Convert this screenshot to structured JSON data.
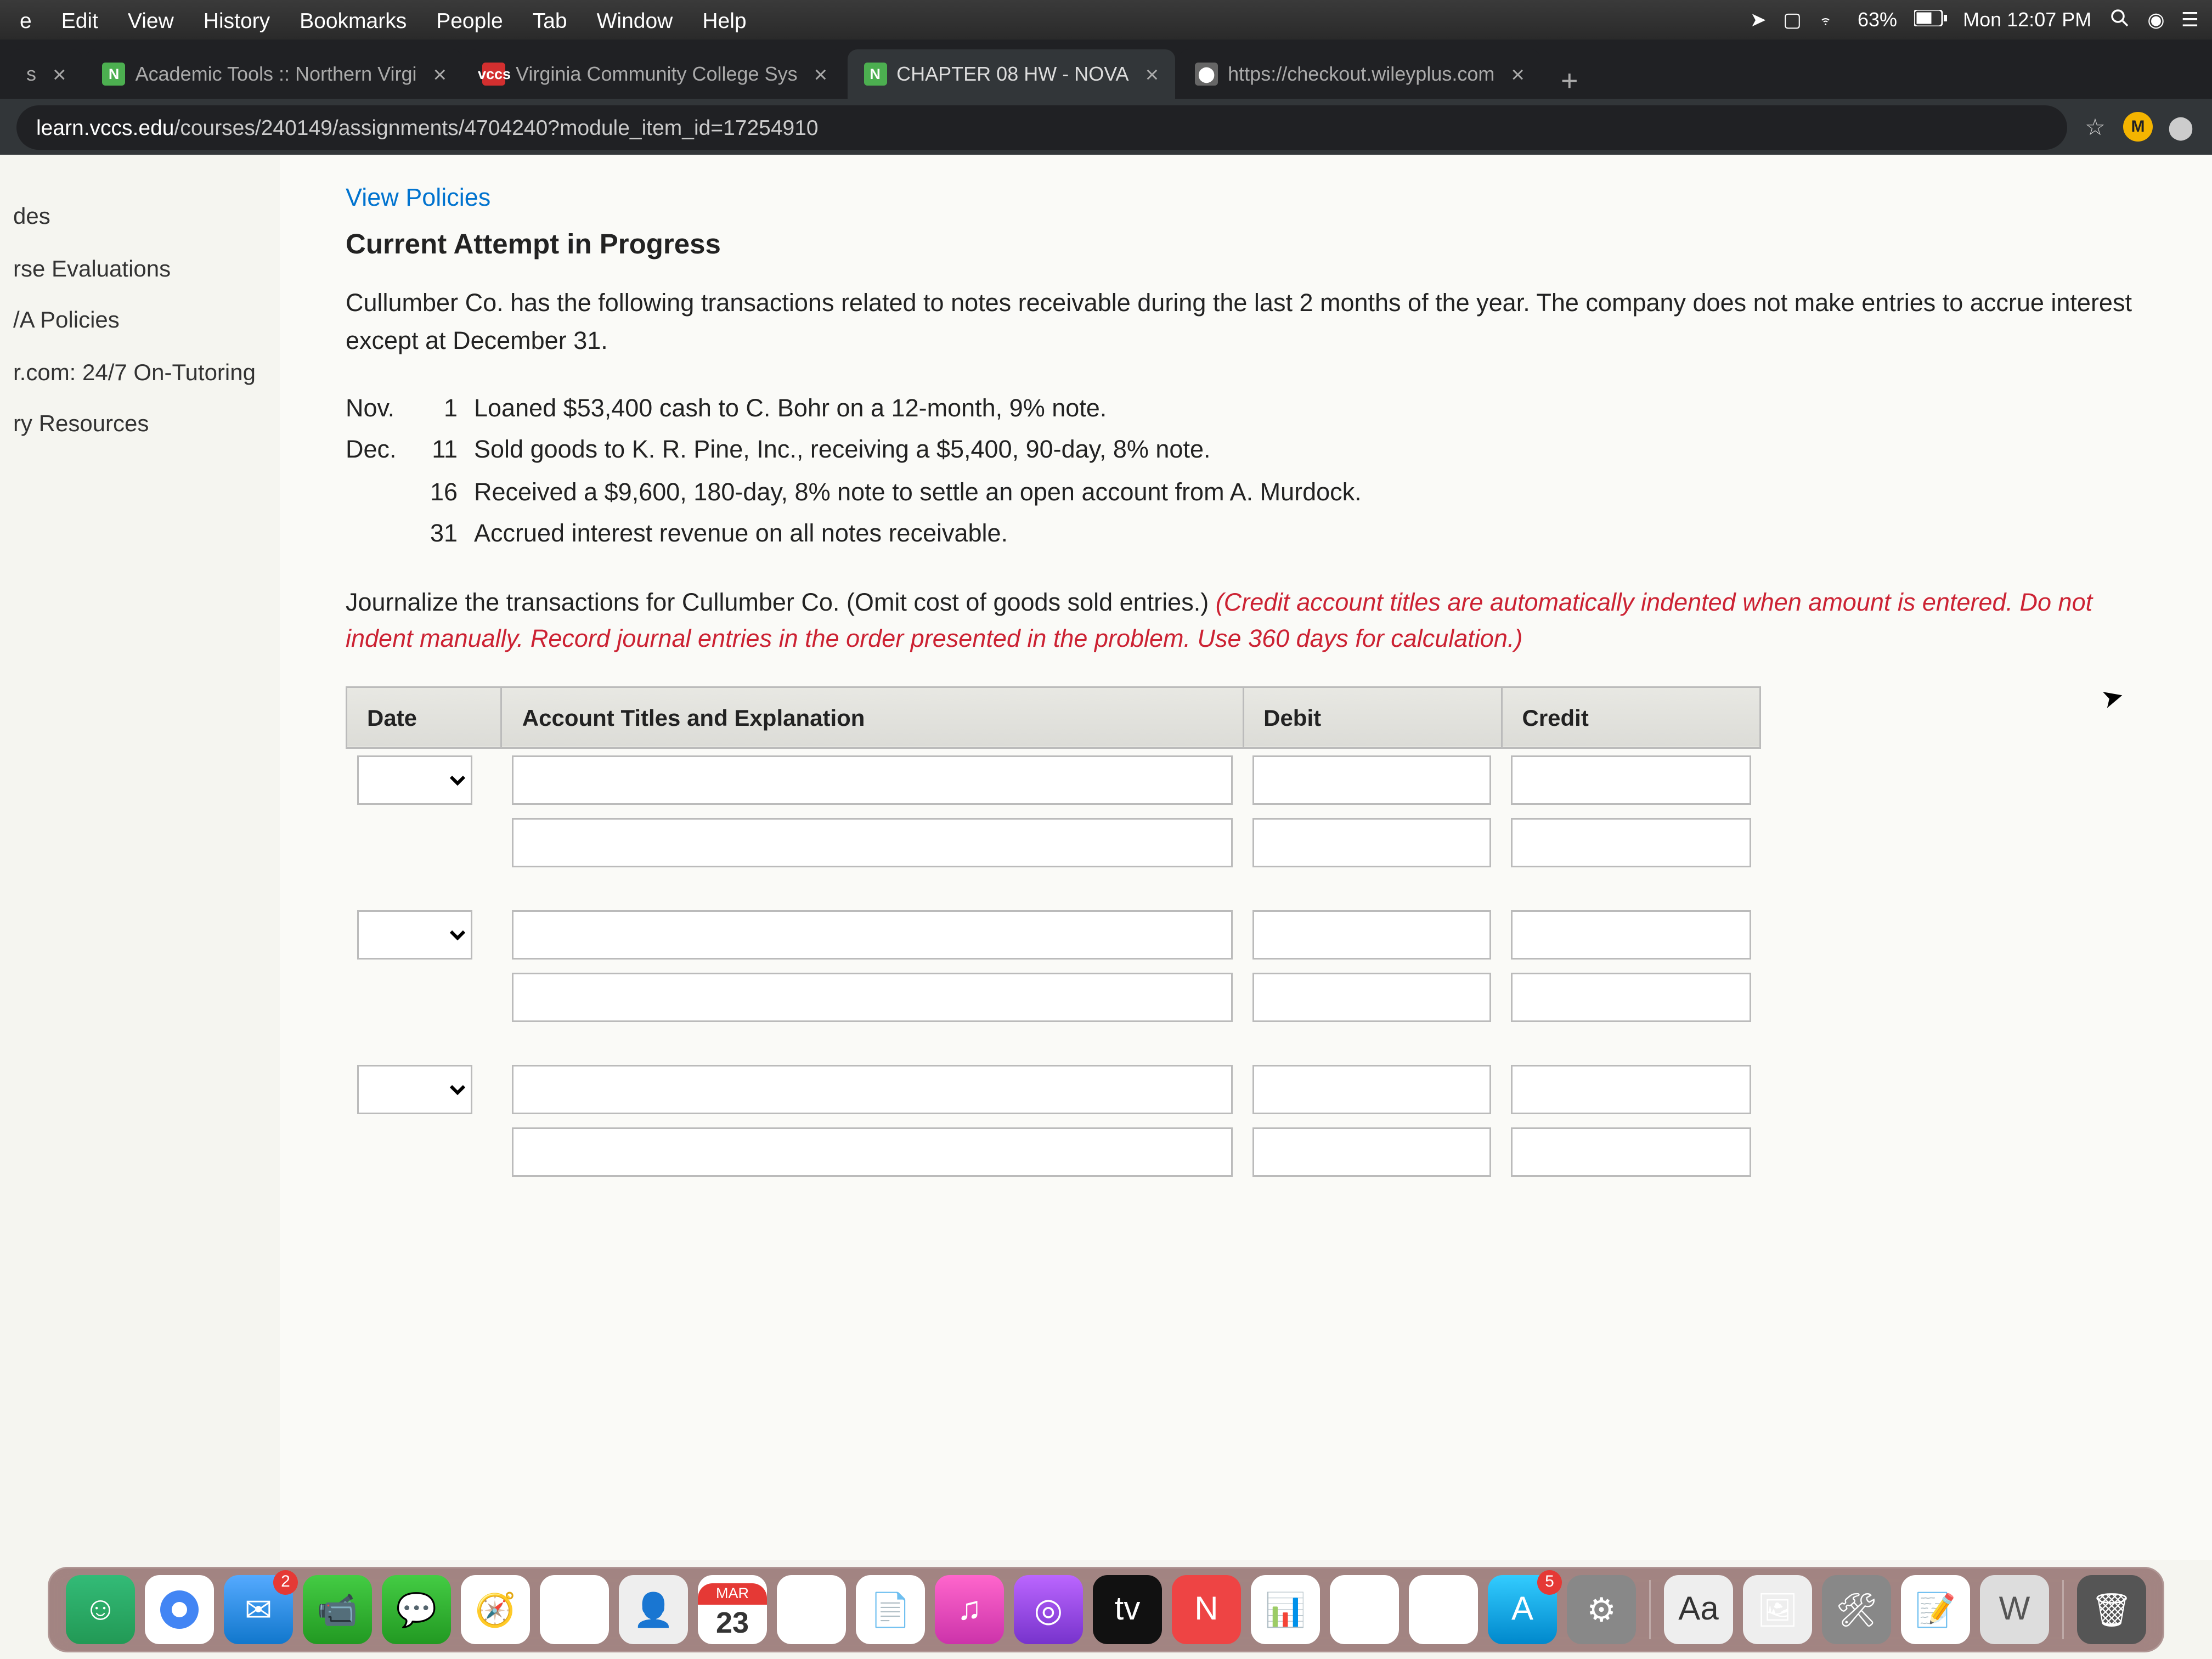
{
  "menubar": {
    "items": [
      "e",
      "Edit",
      "View",
      "History",
      "Bookmarks",
      "People",
      "Tab",
      "Window",
      "Help"
    ],
    "battery": "63%",
    "clock": "Mon 12:07 PM"
  },
  "tabs": [
    {
      "title": "s",
      "favicon": "",
      "active": false
    },
    {
      "title": "Academic Tools :: Northern Virgi",
      "favicon": "N",
      "active": false
    },
    {
      "title": "Virginia Community College Sys",
      "favicon": "vccs",
      "active": false
    },
    {
      "title": "CHAPTER 08 HW - NOVA",
      "favicon": "N",
      "active": true
    },
    {
      "title": "https://checkout.wileyplus.com",
      "favicon": "w",
      "active": false
    }
  ],
  "url": {
    "host": "learn.vccs.edu",
    "path": "/courses/240149/assignments/4704240?module_item_id=17254910"
  },
  "addr": {
    "starLabel": "☆",
    "profile": "M"
  },
  "sidebar": {
    "items": [
      "des",
      "rse Evaluations",
      "/A Policies",
      "r.com: 24/7 On-Tutoring",
      "ry Resources"
    ]
  },
  "page": {
    "viewPolicies": "View Policies",
    "attemptHeading": "Current Attempt in Progress",
    "intro": "Cullumber Co. has the following transactions related to notes receivable during the last 2 months of the year. The company does not make entries to accrue interest except at December 31.",
    "transactions": [
      {
        "month": "Nov.",
        "day": "1",
        "desc": "Loaned $53,400 cash to C. Bohr on a 12-month, 9% note."
      },
      {
        "month": "Dec.",
        "day": "11",
        "desc": "Sold goods to K. R. Pine, Inc., receiving a $5,400, 90-day, 8% note."
      },
      {
        "month": "",
        "day": "16",
        "desc": "Received a $9,600, 180-day, 8% note to settle an open account from A. Murdock."
      },
      {
        "month": "",
        "day": "31",
        "desc": "Accrued interest revenue on all notes receivable."
      }
    ],
    "instruction_plain": "Journalize the transactions for Cullumber Co. (Omit cost of goods sold entries.)",
    "instruction_red": " (Credit account titles are automatically indented when amount is entered. Do not indent manually. Record journal entries in the order presented in the problem. Use 360 days for calculation.)",
    "columns": {
      "date": "Date",
      "acct": "Account Titles and Explanation",
      "debit": "Debit",
      "credit": "Credit"
    }
  },
  "dock": {
    "calendar": {
      "month": "MAR",
      "day": "23"
    },
    "mailBadge": "2",
    "appstoreBadge": "5"
  }
}
